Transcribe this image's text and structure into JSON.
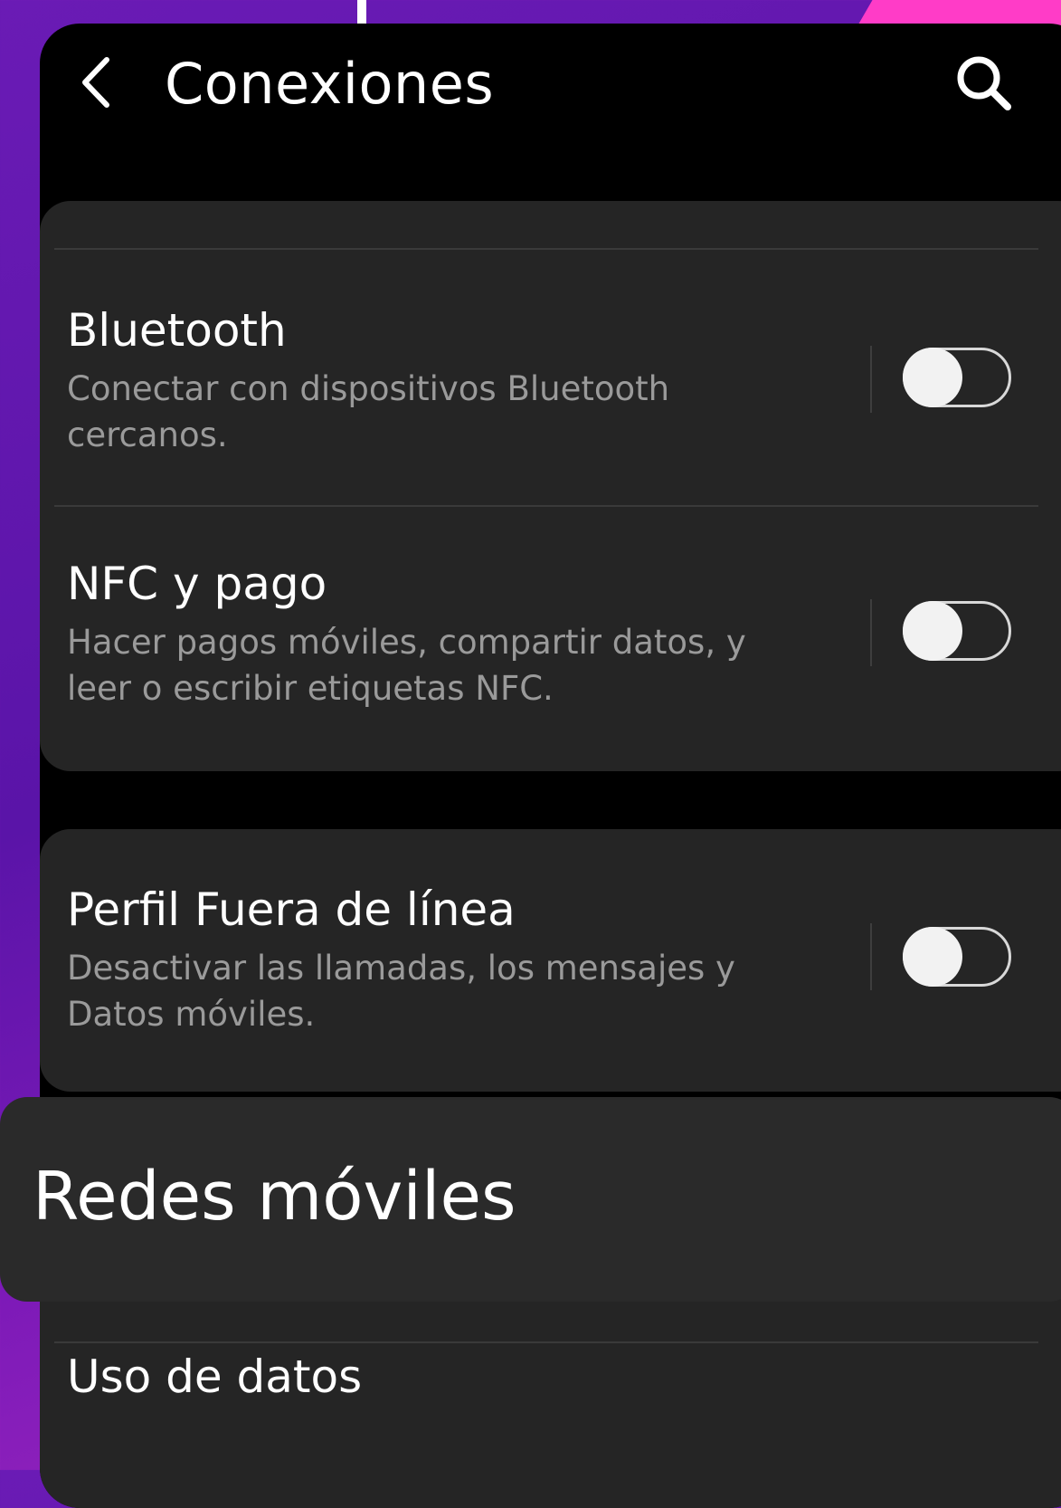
{
  "header": {
    "title": "Conexiones",
    "back_icon": "chevron-left-icon",
    "search_icon": "search-icon"
  },
  "settings": [
    {
      "title": "Bluetooth",
      "description": "Conectar con dispositivos Bluetooth cercanos.",
      "enabled": false
    },
    {
      "title": "NFC y pago",
      "description": "Hacer pagos móviles, compartir datos, y leer o escribir etiquetas NFC.",
      "enabled": false
    },
    {
      "title": "Perfil Fuera de línea",
      "description": "Desactivar las llamadas, los mensajes y Datos móviles.",
      "enabled": false
    }
  ],
  "highlight": {
    "label": "Redes móviles"
  },
  "data_usage": {
    "label": "Uso de datos"
  },
  "colors": {
    "background": "#000000",
    "card": "#252525",
    "title_text": "#ffffff",
    "secondary_text": "#9a9a9a",
    "accent_pink": "#ff3cc7",
    "backdrop_purple": "#6a1bb5"
  }
}
